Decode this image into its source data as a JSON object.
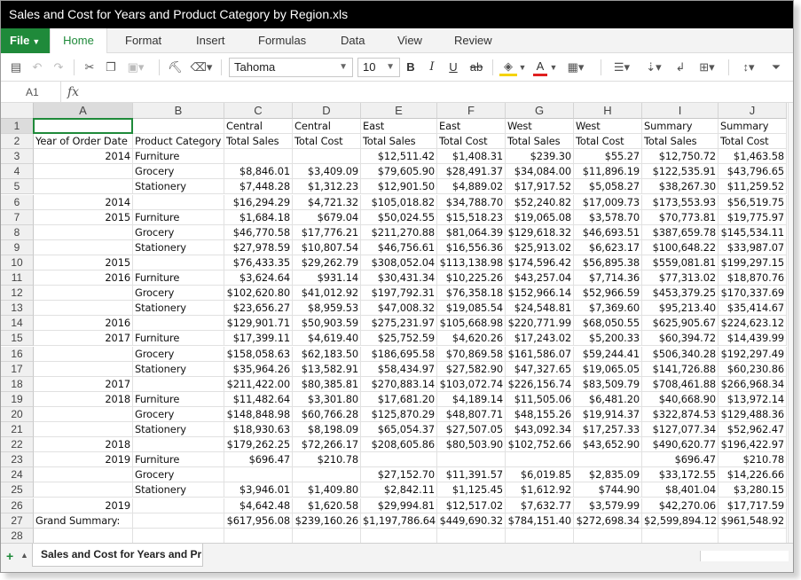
{
  "window": {
    "title": "Sales and Cost for Years and Product Category by Region.xls"
  },
  "ribbon": {
    "file_label": "File",
    "tabs": [
      "Home",
      "Format",
      "Insert",
      "Formulas",
      "Data",
      "View",
      "Review"
    ],
    "active_tab": "Home"
  },
  "toolbar": {
    "font_family": "Tahoma",
    "font_size": "10",
    "bold_label": "B",
    "italic_label": "I",
    "underline_label": "U",
    "strike_label": "ab",
    "font_color_label": "A",
    "highlight_color": "#f5d300",
    "font_color": "#e02020"
  },
  "formula_bar": {
    "cell_ref": "A1",
    "fx_label": "fx",
    "content": ""
  },
  "grid": {
    "columns": [
      "A",
      "B",
      "C",
      "D",
      "E",
      "F",
      "G",
      "H",
      "I",
      "J"
    ],
    "selected_column": "A",
    "selected_row": 1,
    "rows": [
      [
        "",
        "",
        "Central",
        "Central",
        "East",
        "East",
        "West",
        "West",
        "Summary",
        "Summary"
      ],
      [
        "Year of Order Date",
        "Product Category",
        "Total Sales",
        "Total Cost",
        "Total Sales",
        "Total Cost",
        "Total Sales",
        "Total Cost",
        "Total Sales",
        "Total Cost"
      ],
      [
        "2014",
        "Furniture",
        "",
        "",
        "$12,511.42",
        "$1,408.31",
        "$239.30",
        "$55.27",
        "$12,750.72",
        "$1,463.58"
      ],
      [
        "",
        "Grocery",
        "$8,846.01",
        "$3,409.09",
        "$79,605.90",
        "$28,491.37",
        "$34,084.00",
        "$11,896.19",
        "$122,535.91",
        "$43,796.65"
      ],
      [
        "",
        "Stationery",
        "$7,448.28",
        "$1,312.23",
        "$12,901.50",
        "$4,889.02",
        "$17,917.52",
        "$5,058.27",
        "$38,267.30",
        "$11,259.52"
      ],
      [
        "2014",
        "",
        "$16,294.29",
        "$4,721.32",
        "$105,018.82",
        "$34,788.70",
        "$52,240.82",
        "$17,009.73",
        "$173,553.93",
        "$56,519.75"
      ],
      [
        "2015",
        "Furniture",
        "$1,684.18",
        "$679.04",
        "$50,024.55",
        "$15,518.23",
        "$19,065.08",
        "$3,578.70",
        "$70,773.81",
        "$19,775.97"
      ],
      [
        "",
        "Grocery",
        "$46,770.58",
        "$17,776.21",
        "$211,270.88",
        "$81,064.39",
        "$129,618.32",
        "$46,693.51",
        "$387,659.78",
        "$145,534.11"
      ],
      [
        "",
        "Stationery",
        "$27,978.59",
        "$10,807.54",
        "$46,756.61",
        "$16,556.36",
        "$25,913.02",
        "$6,623.17",
        "$100,648.22",
        "$33,987.07"
      ],
      [
        "2015",
        "",
        "$76,433.35",
        "$29,262.79",
        "$308,052.04",
        "$113,138.98",
        "$174,596.42",
        "$56,895.38",
        "$559,081.81",
        "$199,297.15"
      ],
      [
        "2016",
        "Furniture",
        "$3,624.64",
        "$931.14",
        "$30,431.34",
        "$10,225.26",
        "$43,257.04",
        "$7,714.36",
        "$77,313.02",
        "$18,870.76"
      ],
      [
        "",
        "Grocery",
        "$102,620.80",
        "$41,012.92",
        "$197,792.31",
        "$76,358.18",
        "$152,966.14",
        "$52,966.59",
        "$453,379.25",
        "$170,337.69"
      ],
      [
        "",
        "Stationery",
        "$23,656.27",
        "$8,959.53",
        "$47,008.32",
        "$19,085.54",
        "$24,548.81",
        "$7,369.60",
        "$95,213.40",
        "$35,414.67"
      ],
      [
        "2016",
        "",
        "$129,901.71",
        "$50,903.59",
        "$275,231.97",
        "$105,668.98",
        "$220,771.99",
        "$68,050.55",
        "$625,905.67",
        "$224,623.12"
      ],
      [
        "2017",
        "Furniture",
        "$17,399.11",
        "$4,619.40",
        "$25,752.59",
        "$4,620.26",
        "$17,243.02",
        "$5,200.33",
        "$60,394.72",
        "$14,439.99"
      ],
      [
        "",
        "Grocery",
        "$158,058.63",
        "$62,183.50",
        "$186,695.58",
        "$70,869.58",
        "$161,586.07",
        "$59,244.41",
        "$506,340.28",
        "$192,297.49"
      ],
      [
        "",
        "Stationery",
        "$35,964.26",
        "$13,582.91",
        "$58,434.97",
        "$27,582.90",
        "$47,327.65",
        "$19,065.05",
        "$141,726.88",
        "$60,230.86"
      ],
      [
        "2017",
        "",
        "$211,422.00",
        "$80,385.81",
        "$270,883.14",
        "$103,072.74",
        "$226,156.74",
        "$83,509.79",
        "$708,461.88",
        "$266,968.34"
      ],
      [
        "2018",
        "Furniture",
        "$11,482.64",
        "$3,301.80",
        "$17,681.20",
        "$4,189.14",
        "$11,505.06",
        "$6,481.20",
        "$40,668.90",
        "$13,972.14"
      ],
      [
        "",
        "Grocery",
        "$148,848.98",
        "$60,766.28",
        "$125,870.29",
        "$48,807.71",
        "$48,155.26",
        "$19,914.37",
        "$322,874.53",
        "$129,488.36"
      ],
      [
        "",
        "Stationery",
        "$18,930.63",
        "$8,198.09",
        "$65,054.37",
        "$27,507.05",
        "$43,092.34",
        "$17,257.33",
        "$127,077.34",
        "$52,962.47"
      ],
      [
        "2018",
        "",
        "$179,262.25",
        "$72,266.17",
        "$208,605.86",
        "$80,503.90",
        "$102,752.66",
        "$43,652.90",
        "$490,620.77",
        "$196,422.97"
      ],
      [
        "2019",
        "Furniture",
        "$696.47",
        "$210.78",
        "",
        "",
        "",
        "",
        "$696.47",
        "$210.78"
      ],
      [
        "",
        "Grocery",
        "",
        "",
        "$27,152.70",
        "$11,391.57",
        "$6,019.85",
        "$2,835.09",
        "$33,172.55",
        "$14,226.66"
      ],
      [
        "",
        "Stationery",
        "$3,946.01",
        "$1,409.80",
        "$2,842.11",
        "$1,125.45",
        "$1,612.92",
        "$744.90",
        "$8,401.04",
        "$3,280.15"
      ],
      [
        "2019",
        "",
        "$4,642.48",
        "$1,620.58",
        "$29,994.81",
        "$12,517.02",
        "$7,632.77",
        "$3,579.99",
        "$42,270.06",
        "$17,717.59"
      ],
      [
        "Grand Summary:",
        "",
        "$617,956.08",
        "$239,160.26",
        "$1,197,786.64",
        "$449,690.32",
        "$784,151.40",
        "$272,698.34",
        "$2,599,894.12",
        "$961,548.92"
      ],
      [
        "",
        "",
        "",
        "",
        "",
        "",
        "",
        "",
        "",
        ""
      ]
    ]
  },
  "sheets": {
    "active_tab_label": "Sales and Cost for Years and Pr"
  }
}
